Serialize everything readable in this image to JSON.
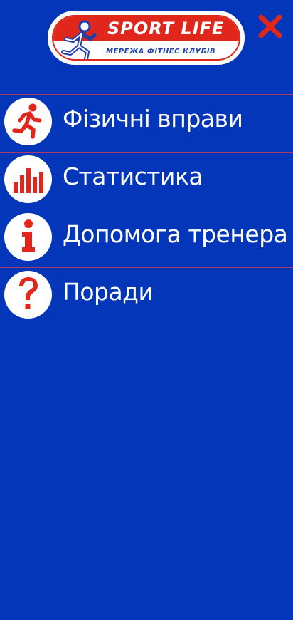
{
  "header": {
    "logo": {
      "brand": "SPORT LIFE",
      "tagline": "МЕРЕЖА ФІТНЕС КЛУБІВ"
    },
    "close_icon": "close-icon"
  },
  "menu": {
    "items": [
      {
        "label": "Фізичні вправи",
        "icon": "running-icon"
      },
      {
        "label": "Статистика",
        "icon": "bar-chart-icon"
      },
      {
        "label": "Допомога тренера",
        "icon": "info-icon"
      },
      {
        "label": "Поради",
        "icon": "question-icon"
      }
    ]
  },
  "colors": {
    "background": "#0336b8",
    "accent": "#e1261c",
    "divider": "#b03b6a",
    "text": "#ffffff"
  }
}
